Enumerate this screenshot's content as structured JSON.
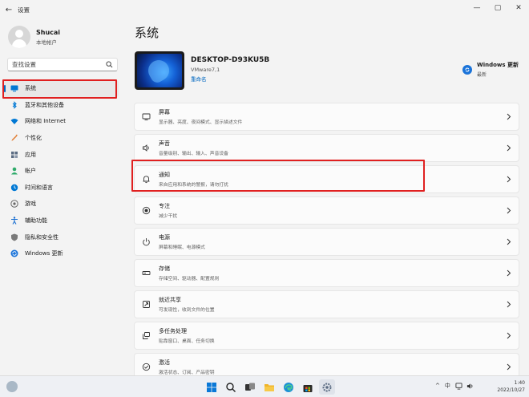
{
  "window": {
    "title": "设置",
    "controls": [
      "—",
      "▢",
      "✕"
    ]
  },
  "user": {
    "name": "Shucai",
    "account_type": "本地帐户"
  },
  "search": {
    "placeholder": "查找设置"
  },
  "sidebar": {
    "items": [
      {
        "label": "系统",
        "icon": "monitor-icon",
        "color": "#0078d4"
      },
      {
        "label": "蓝牙和其他设备",
        "icon": "bluetooth-icon",
        "color": "#0078d4"
      },
      {
        "label": "网络和 Internet",
        "icon": "wifi-icon",
        "color": "#0078d4"
      },
      {
        "label": "个性化",
        "icon": "pencil-icon",
        "color": "#e07a2e"
      },
      {
        "label": "应用",
        "icon": "apps-icon",
        "color": "#5a6b82"
      },
      {
        "label": "帐户",
        "icon": "person-icon",
        "color": "#2eaa6a"
      },
      {
        "label": "时间和语言",
        "icon": "globe-clock-icon",
        "color": "#0078d4"
      },
      {
        "label": "游戏",
        "icon": "gamepad-icon",
        "color": "#666666"
      },
      {
        "label": "辅助功能",
        "icon": "accessibility-icon",
        "color": "#1a6fd1"
      },
      {
        "label": "隐私和安全性",
        "icon": "shield-icon",
        "color": "#7a7a7a"
      },
      {
        "label": "Windows 更新",
        "icon": "update-icon",
        "color": "#1a73d9"
      }
    ]
  },
  "main": {
    "title": "系统",
    "device": {
      "name": "DESKTOP-D93KU5B",
      "model": "VMware7,1",
      "rename_link": "重命名"
    },
    "windows_update": {
      "title": "Windows 更新",
      "status": "最新"
    },
    "cards": [
      {
        "title": "屏幕",
        "subtitle": "显示器、亮度、夜间模式、显示描述文件",
        "icon": "display-icon"
      },
      {
        "title": "声音",
        "subtitle": "音量级别、输出、输入、声音设备",
        "icon": "speaker-icon"
      },
      {
        "title": "通知",
        "subtitle": "来自应用和系统的警报，请勿打扰",
        "icon": "bell-icon"
      },
      {
        "title": "专注",
        "subtitle": "减少干扰",
        "icon": "focus-icon"
      },
      {
        "title": "电源",
        "subtitle": "屏幕和睡眠、电源模式",
        "icon": "power-icon"
      },
      {
        "title": "存储",
        "subtitle": "存储空间、驱动器、配置规则",
        "icon": "storage-icon"
      },
      {
        "title": "就近共享",
        "subtitle": "可发现性，收到文件的位置",
        "icon": "nearby-share-icon"
      },
      {
        "title": "多任务处理",
        "subtitle": "贴靠窗口、桌面、任务切换",
        "icon": "multitask-icon"
      },
      {
        "title": "激活",
        "subtitle": "激活状态、订阅、产品密钥",
        "icon": "activation-icon"
      }
    ]
  },
  "taskbar": {
    "apps": [
      {
        "name": "start",
        "icon": "windows-logo-icon"
      },
      {
        "name": "search",
        "icon": "search-icon"
      },
      {
        "name": "task-view",
        "icon": "task-view-icon"
      },
      {
        "name": "file-explorer",
        "icon": "folder-icon"
      },
      {
        "name": "edge",
        "icon": "edge-icon"
      },
      {
        "name": "store",
        "icon": "store-icon"
      },
      {
        "name": "settings",
        "icon": "gear-icon"
      }
    ],
    "tray": {
      "chevron": "^",
      "ime": "中"
    },
    "clock": {
      "time": "1:40",
      "date": "2022/10/27"
    }
  },
  "annotations": {
    "highlight_color": "#e02020"
  }
}
